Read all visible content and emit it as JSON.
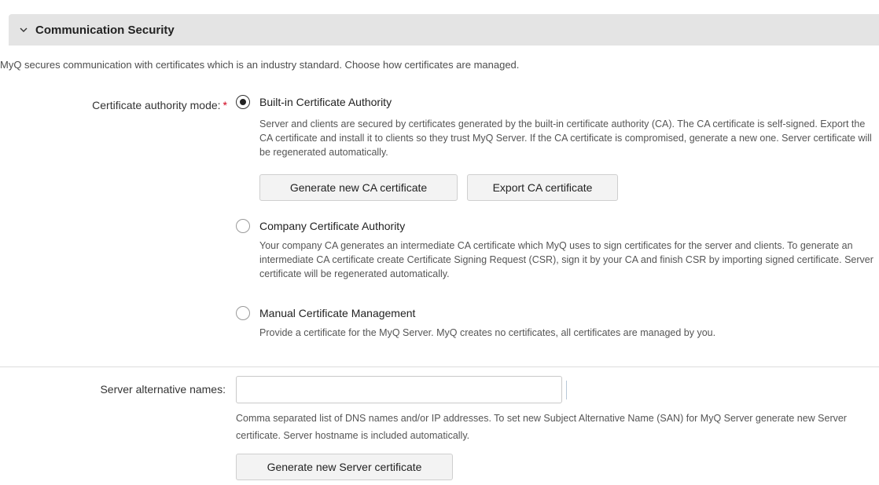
{
  "section": {
    "title": "Communication Security",
    "intro": "MyQ secures communication with certificates which is an industry standard. Choose how certificates are managed."
  },
  "ca_mode": {
    "label": "Certificate authority mode:",
    "required_mark": "*",
    "selected": "builtin",
    "options": [
      {
        "id": "builtin",
        "label": "Built-in Certificate Authority",
        "checked": true,
        "description": "Server and clients are secured by certificates generated by the built-in certificate authority (CA). The CA certificate is self-signed. Export the CA certificate and install it to clients so they trust MyQ Server. If the CA certificate is compromised, generate a new one. Server certificate will be regenerated automatically."
      },
      {
        "id": "company",
        "label": "Company Certificate Authority",
        "checked": false,
        "description": "Your company CA generates an intermediate CA certificate which MyQ uses to sign certificates for the server and clients. To generate an intermediate CA certificate create Certificate Signing Request (CSR), sign it by your CA and finish CSR by importing signed certificate. Server certificate will be regenerated automatically."
      },
      {
        "id": "manual",
        "label": "Manual Certificate Management",
        "checked": false,
        "description": "Provide a certificate for the MyQ Server. MyQ creates no certificates, all certificates are managed by you."
      }
    ],
    "buttons": {
      "generate_ca": "Generate new CA certificate",
      "export_ca": "Export CA certificate"
    }
  },
  "san": {
    "label": "Server alternative names:",
    "value": "",
    "placeholder": "",
    "description": "Comma separated list of DNS names and/or IP addresses. To set new Subject Alternative Name (SAN) for MyQ Server generate new Server certificate. Server hostname is included automatically.",
    "button": "Generate new Server certificate"
  },
  "icons": {
    "collapse": "chevron-down-icon"
  }
}
